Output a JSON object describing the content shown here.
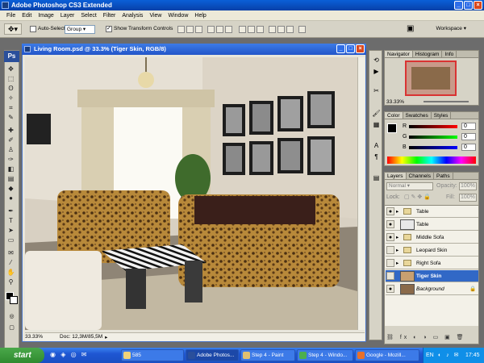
{
  "app": {
    "title": "Adobe Photoshop CS3 Extended",
    "logo": "Ps"
  },
  "menu": [
    "File",
    "Edit",
    "Image",
    "Layer",
    "Select",
    "Filter",
    "Analysis",
    "View",
    "Window",
    "Help"
  ],
  "options": {
    "auto_select_label": "Auto-Select:",
    "auto_select_value": "Group",
    "transform_label": "Show Transform Controls",
    "workspace_label": "Workspace"
  },
  "document": {
    "title": "Living Room.psd @ 33.3% (Tiger Skin, RGB/8)",
    "zoom": "33.33%",
    "doc_size": "Doc: 12,3M/85,5M"
  },
  "navigator": {
    "tabs": [
      "Navigator",
      "Histogram",
      "Info"
    ],
    "zoom": "33.33%"
  },
  "color": {
    "tabs": [
      "Color",
      "Swatches",
      "Styles"
    ],
    "channels": [
      {
        "label": "R",
        "value": "0"
      },
      {
        "label": "G",
        "value": "0"
      },
      {
        "label": "B",
        "value": "0"
      }
    ]
  },
  "layers": {
    "tabs": [
      "Layers",
      "Channels",
      "Paths"
    ],
    "blend_mode": "Normal",
    "opacity_label": "Opacity:",
    "opacity": "100%",
    "lock_label": "Lock:",
    "fill_label": "Fill:",
    "fill": "100%",
    "items": [
      {
        "name": "Table",
        "type": "folder",
        "visible": true,
        "selected": false
      },
      {
        "name": "Table",
        "type": "image",
        "visible": true,
        "selected": false
      },
      {
        "name": "Middle Sofa",
        "type": "folder",
        "visible": true,
        "selected": false
      },
      {
        "name": "Leopard Skin",
        "type": "folder",
        "visible": false,
        "selected": false
      },
      {
        "name": "Right Sofa",
        "type": "folder",
        "visible": false,
        "selected": false
      },
      {
        "name": "Tiger Skin",
        "type": "image",
        "visible": false,
        "selected": true
      },
      {
        "name": "Background",
        "type": "image",
        "visible": true,
        "selected": false
      }
    ]
  },
  "taskbar": {
    "start": "start",
    "items": [
      {
        "label": "585",
        "active": false
      },
      {
        "label": "Adobe Photos...",
        "active": true
      },
      {
        "label": "Step 4 - Paint",
        "active": false
      },
      {
        "label": "Step 4 - Windo...",
        "active": false
      },
      {
        "label": "Google - Mozill...",
        "active": false
      }
    ],
    "lang": "EN",
    "clock": "17:45"
  },
  "colors": {
    "xp_blue": "#0a5fd8",
    "selection": "#3168c6",
    "start_green": "#2f8a2f"
  }
}
